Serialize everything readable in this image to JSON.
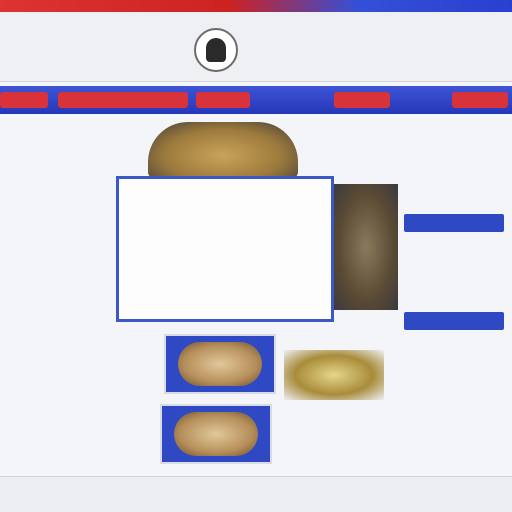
{
  "header": {
    "title_left": "",
    "title_right": "",
    "tagline_left": "",
    "tagline_right": ""
  },
  "nav": {
    "items": [
      "",
      "",
      "",
      "",
      ""
    ]
  },
  "sidebar": {
    "groups": [
      {
        "heading": "",
        "links": [
          "",
          "",
          "",
          "",
          ""
        ]
      },
      {
        "heading": "",
        "links": [
          "",
          "",
          ""
        ]
      },
      {
        "heading": "",
        "links": [
          "",
          "",
          "",
          "",
          "",
          "",
          "",
          "",
          "",
          "",
          ""
        ]
      }
    ]
  },
  "main": {
    "notice_lines": [
      "",
      "",
      "",
      "",
      "",
      "",
      "",
      "",
      "",
      ""
    ]
  },
  "rightcol": {
    "texts": [
      "",
      "",
      "",
      "",
      "",
      "",
      "",
      ""
    ],
    "buttons": [
      "",
      ""
    ]
  },
  "footer": {
    "text": "",
    "corner": ""
  },
  "colors": {
    "brand_red": "#d8323a",
    "brand_blue": "#2f48c4",
    "page_bg": "#f4f5f8"
  }
}
